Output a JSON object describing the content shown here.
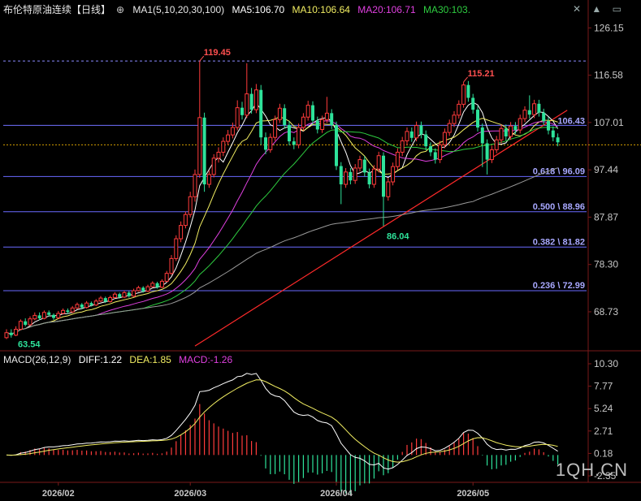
{
  "header": {
    "instrument": "布伦特原油连续",
    "period": "【日线】",
    "ma_label": "MA1(5,10,20,30,100)",
    "ma5": "MA5:106.70",
    "ma10": "MA10:106.64",
    "ma20": "MA20:106.71",
    "ma30": "MA30:103."
  },
  "icons": [
    "target-icon",
    "close-icon",
    "chevron-up-icon",
    "minimize-icon",
    "restore-icon"
  ],
  "macd_header": {
    "label": "MACD(26,12,9)",
    "diff": "DIFF:1.22",
    "dea": "DEA:1.85",
    "macd": "MACD:-1.26"
  },
  "watermark": "1QH.CN",
  "colors": {
    "up": "#ff3b3b",
    "down": "#2ee29a",
    "ma5": "#ffffff",
    "ma10": "#f2ee62",
    "ma20": "#e040e0",
    "ma30": "#2ecc40",
    "ma100": "#9a9a9a",
    "trendline": "#ff2a2a",
    "fib": "#6a6aff",
    "axis_text": "#c8c8c8"
  },
  "chart_data": [
    {
      "type": "candlestick",
      "title": "布伦特原油连续【日线】",
      "y_axis_ticks": [
        "126.15",
        "116.58",
        "107.01",
        "97.44",
        "87.87",
        "78.30",
        "68.73"
      ],
      "ylim": [
        61.5,
        128.5
      ],
      "x_tick_labels": [
        "2026/02",
        "2026/03",
        "2026/04",
        "2026/05"
      ],
      "annotations": [
        {
          "text": "119.45",
          "value": 119.45,
          "kind": "high"
        },
        {
          "text": "115.21",
          "value": 115.21,
          "kind": "high"
        },
        {
          "text": "86.04",
          "value": 86.04,
          "kind": "low"
        },
        {
          "text": "63.54",
          "value": 63.54,
          "kind": "low"
        },
        {
          "text": "106.43",
          "value": 106.43,
          "kind": "last"
        }
      ],
      "fibonacci": [
        {
          "label": "0.618 \\ 96.09",
          "value": 96.09
        },
        {
          "label": "0.500 \\ 88.96",
          "value": 88.96
        },
        {
          "label": "0.382 \\ 81.82",
          "value": 81.82
        },
        {
          "label": "0.236 \\ 72.99",
          "value": 72.99
        }
      ],
      "reference_levels": [
        119.45,
        106.43,
        102.5
      ],
      "trendline": {
        "start": {
          "index": 40,
          "value": 61.8
        },
        "end": {
          "index": 119,
          "value": 109.5
        }
      },
      "series_names": [
        "MA5",
        "MA10",
        "MA20",
        "MA30",
        "MA100"
      ],
      "close": [
        64.5,
        64.0,
        65.2,
        66.8,
        66.1,
        67.3,
        68.0,
        67.4,
        68.6,
        68.1,
        67.5,
        68.4,
        69.0,
        68.7,
        69.5,
        70.2,
        69.6,
        70.5,
        70.1,
        70.9,
        71.5,
        70.8,
        71.6,
        72.3,
        71.7,
        72.6,
        71.9,
        73.0,
        73.6,
        72.9,
        73.8,
        74.5,
        73.7,
        74.9,
        76.5,
        79.5,
        83.5,
        86.2,
        88.4,
        92.0,
        96.5,
        108.0,
        94.5,
        96.5,
        99.8,
        101.0,
        103.2,
        104.5,
        106.0,
        110.0,
        108.5,
        112.8,
        109.6,
        113.6,
        104.0,
        101.5,
        104.0,
        107.6,
        109.9,
        106.5,
        103.2,
        102.5,
        106.0,
        108.1,
        110.5,
        107.4,
        105.6,
        107.6,
        108.9,
        106.5,
        98.2,
        94.5,
        97.0,
        95.3,
        97.8,
        99.5,
        96.9,
        94.5,
        97.6,
        100.3,
        92.0,
        95.0,
        98.1,
        101.0,
        103.3,
        105.2,
        103.9,
        106.4,
        104.6,
        102.2,
        101.0,
        99.5,
        102.5,
        105.0,
        106.8,
        108.5,
        110.7,
        114.6,
        112.0,
        109.6,
        106.0,
        102.8,
        99.5,
        101.5,
        103.5,
        105.8,
        104.2,
        106.3,
        105.5,
        107.8,
        109.5,
        108.6,
        110.8,
        109.0,
        107.3,
        105.4,
        104.0,
        103.0
      ],
      "candles": [
        {
          "o": 63.5,
          "h": 65.2,
          "l": 63.2,
          "c": 64.5
        },
        {
          "o": 64.5,
          "h": 65.2,
          "l": 63.5,
          "c": 64.0
        },
        {
          "o": 64.0,
          "h": 65.8,
          "l": 63.8,
          "c": 65.2
        },
        {
          "o": 65.2,
          "h": 67.2,
          "l": 65.0,
          "c": 66.8
        },
        {
          "o": 66.8,
          "h": 67.4,
          "l": 65.8,
          "c": 66.1
        },
        {
          "o": 66.1,
          "h": 67.8,
          "l": 65.9,
          "c": 67.3
        },
        {
          "o": 67.3,
          "h": 68.6,
          "l": 67.0,
          "c": 68.0
        },
        {
          "o": 68.0,
          "h": 68.6,
          "l": 67.0,
          "c": 67.4
        },
        {
          "o": 67.4,
          "h": 69.0,
          "l": 67.2,
          "c": 68.6
        },
        {
          "o": 68.6,
          "h": 69.0,
          "l": 67.8,
          "c": 68.1
        },
        {
          "o": 68.1,
          "h": 68.4,
          "l": 67.1,
          "c": 67.5
        },
        {
          "o": 67.5,
          "h": 68.9,
          "l": 67.3,
          "c": 68.4
        },
        {
          "o": 68.4,
          "h": 69.4,
          "l": 68.2,
          "c": 69.0
        },
        {
          "o": 69.0,
          "h": 69.4,
          "l": 68.3,
          "c": 68.7
        },
        {
          "o": 68.7,
          "h": 69.9,
          "l": 68.5,
          "c": 69.5
        },
        {
          "o": 69.5,
          "h": 70.6,
          "l": 69.3,
          "c": 70.2
        },
        {
          "o": 70.2,
          "h": 70.5,
          "l": 69.2,
          "c": 69.6
        },
        {
          "o": 69.6,
          "h": 70.9,
          "l": 69.4,
          "c": 70.5
        },
        {
          "o": 70.5,
          "h": 70.8,
          "l": 69.8,
          "c": 70.1
        },
        {
          "o": 70.1,
          "h": 71.3,
          "l": 69.9,
          "c": 70.9
        },
        {
          "o": 70.9,
          "h": 71.9,
          "l": 70.7,
          "c": 71.5
        },
        {
          "o": 71.5,
          "h": 71.8,
          "l": 70.5,
          "c": 70.8
        },
        {
          "o": 70.8,
          "h": 72.0,
          "l": 70.6,
          "c": 71.6
        },
        {
          "o": 71.6,
          "h": 72.7,
          "l": 71.4,
          "c": 72.3
        },
        {
          "o": 72.3,
          "h": 72.6,
          "l": 71.4,
          "c": 71.7
        },
        {
          "o": 71.7,
          "h": 73.0,
          "l": 71.5,
          "c": 72.6
        },
        {
          "o": 72.6,
          "h": 72.9,
          "l": 71.6,
          "c": 71.9
        },
        {
          "o": 71.9,
          "h": 73.4,
          "l": 71.7,
          "c": 73.0
        },
        {
          "o": 73.0,
          "h": 74.0,
          "l": 72.8,
          "c": 73.6
        },
        {
          "o": 73.6,
          "h": 73.9,
          "l": 72.6,
          "c": 72.9
        },
        {
          "o": 72.9,
          "h": 74.2,
          "l": 72.7,
          "c": 73.8
        },
        {
          "o": 73.8,
          "h": 74.9,
          "l": 73.6,
          "c": 74.5
        },
        {
          "o": 74.5,
          "h": 74.8,
          "l": 73.4,
          "c": 73.7
        },
        {
          "o": 73.7,
          "h": 75.3,
          "l": 73.5,
          "c": 74.9
        },
        {
          "o": 74.9,
          "h": 77.0,
          "l": 74.7,
          "c": 76.5
        },
        {
          "o": 76.5,
          "h": 80.2,
          "l": 76.2,
          "c": 79.5
        },
        {
          "o": 79.5,
          "h": 84.2,
          "l": 79.0,
          "c": 83.5
        },
        {
          "o": 83.5,
          "h": 87.0,
          "l": 82.8,
          "c": 86.2
        },
        {
          "o": 86.2,
          "h": 89.0,
          "l": 85.6,
          "c": 88.4
        },
        {
          "o": 88.4,
          "h": 93.0,
          "l": 87.8,
          "c": 92.0
        },
        {
          "o": 92.0,
          "h": 97.5,
          "l": 91.0,
          "c": 96.5
        },
        {
          "o": 96.5,
          "h": 119.45,
          "l": 95.8,
          "c": 108.0
        },
        {
          "o": 108.0,
          "h": 109.0,
          "l": 93.0,
          "c": 94.5
        },
        {
          "o": 94.5,
          "h": 97.3,
          "l": 93.8,
          "c": 96.5
        },
        {
          "o": 96.5,
          "h": 100.6,
          "l": 95.9,
          "c": 99.8
        },
        {
          "o": 99.8,
          "h": 102.0,
          "l": 98.9,
          "c": 101.0
        },
        {
          "o": 101.0,
          "h": 104.0,
          "l": 100.2,
          "c": 103.2
        },
        {
          "o": 103.2,
          "h": 105.5,
          "l": 102.5,
          "c": 104.5
        },
        {
          "o": 104.5,
          "h": 107.0,
          "l": 103.8,
          "c": 106.0
        },
        {
          "o": 106.0,
          "h": 111.5,
          "l": 105.4,
          "c": 110.0
        },
        {
          "o": 110.0,
          "h": 111.2,
          "l": 107.6,
          "c": 108.5
        },
        {
          "o": 108.5,
          "h": 119.0,
          "l": 107.9,
          "c": 112.8
        },
        {
          "o": 112.8,
          "h": 114.0,
          "l": 108.8,
          "c": 109.6
        },
        {
          "o": 109.6,
          "h": 114.8,
          "l": 108.9,
          "c": 113.6
        },
        {
          "o": 113.6,
          "h": 114.6,
          "l": 102.5,
          "c": 104.0
        },
        {
          "o": 104.0,
          "h": 105.0,
          "l": 100.6,
          "c": 101.5
        },
        {
          "o": 101.5,
          "h": 104.8,
          "l": 100.9,
          "c": 104.0
        },
        {
          "o": 104.0,
          "h": 108.4,
          "l": 103.3,
          "c": 107.6
        },
        {
          "o": 107.6,
          "h": 110.8,
          "l": 106.9,
          "c": 109.9
        },
        {
          "o": 109.9,
          "h": 110.7,
          "l": 105.8,
          "c": 106.5
        },
        {
          "o": 106.5,
          "h": 107.3,
          "l": 102.4,
          "c": 103.2
        },
        {
          "o": 103.2,
          "h": 104.0,
          "l": 101.6,
          "c": 102.5
        },
        {
          "o": 102.5,
          "h": 106.8,
          "l": 101.8,
          "c": 106.0
        },
        {
          "o": 106.0,
          "h": 108.9,
          "l": 105.3,
          "c": 108.1
        },
        {
          "o": 108.1,
          "h": 111.4,
          "l": 107.4,
          "c": 110.5
        },
        {
          "o": 110.5,
          "h": 111.3,
          "l": 106.6,
          "c": 107.4
        },
        {
          "o": 107.4,
          "h": 108.2,
          "l": 104.8,
          "c": 105.6
        },
        {
          "o": 105.6,
          "h": 108.4,
          "l": 104.9,
          "c": 107.6
        },
        {
          "o": 107.6,
          "h": 112.2,
          "l": 106.9,
          "c": 108.9
        },
        {
          "o": 108.9,
          "h": 109.7,
          "l": 105.7,
          "c": 106.5
        },
        {
          "o": 106.5,
          "h": 107.2,
          "l": 97.4,
          "c": 98.2
        },
        {
          "o": 98.2,
          "h": 99.0,
          "l": 90.5,
          "c": 94.5
        },
        {
          "o": 94.5,
          "h": 97.8,
          "l": 93.8,
          "c": 97.0
        },
        {
          "o": 97.0,
          "h": 97.8,
          "l": 94.5,
          "c": 95.3
        },
        {
          "o": 95.3,
          "h": 98.6,
          "l": 94.6,
          "c": 97.8
        },
        {
          "o": 97.8,
          "h": 100.3,
          "l": 97.1,
          "c": 99.5
        },
        {
          "o": 99.5,
          "h": 100.2,
          "l": 96.1,
          "c": 96.9
        },
        {
          "o": 96.9,
          "h": 97.7,
          "l": 93.7,
          "c": 94.5
        },
        {
          "o": 94.5,
          "h": 98.4,
          "l": 93.8,
          "c": 97.6
        },
        {
          "o": 97.6,
          "h": 101.1,
          "l": 96.9,
          "c": 100.3
        },
        {
          "o": 100.3,
          "h": 101.0,
          "l": 86.04,
          "c": 92.0
        },
        {
          "o": 92.0,
          "h": 95.8,
          "l": 91.2,
          "c": 95.0
        },
        {
          "o": 95.0,
          "h": 98.9,
          "l": 94.3,
          "c": 98.1
        },
        {
          "o": 98.1,
          "h": 101.8,
          "l": 97.4,
          "c": 101.0
        },
        {
          "o": 101.0,
          "h": 104.1,
          "l": 100.2,
          "c": 103.3
        },
        {
          "o": 103.3,
          "h": 106.0,
          "l": 102.5,
          "c": 105.2
        },
        {
          "o": 105.2,
          "h": 106.0,
          "l": 103.1,
          "c": 103.9
        },
        {
          "o": 103.9,
          "h": 107.2,
          "l": 103.2,
          "c": 106.4
        },
        {
          "o": 106.4,
          "h": 107.2,
          "l": 103.8,
          "c": 104.6
        },
        {
          "o": 104.6,
          "h": 105.4,
          "l": 101.4,
          "c": 102.2
        },
        {
          "o": 102.2,
          "h": 103.0,
          "l": 100.2,
          "c": 101.0
        },
        {
          "o": 101.0,
          "h": 101.8,
          "l": 98.7,
          "c": 99.5
        },
        {
          "o": 99.5,
          "h": 103.3,
          "l": 98.8,
          "c": 102.5
        },
        {
          "o": 102.5,
          "h": 105.8,
          "l": 101.8,
          "c": 105.0
        },
        {
          "o": 105.0,
          "h": 107.6,
          "l": 104.3,
          "c": 106.8
        },
        {
          "o": 106.8,
          "h": 109.3,
          "l": 106.1,
          "c": 108.5
        },
        {
          "o": 108.5,
          "h": 111.5,
          "l": 107.8,
          "c": 110.7
        },
        {
          "o": 110.7,
          "h": 115.21,
          "l": 110.0,
          "c": 114.6
        },
        {
          "o": 114.6,
          "h": 115.4,
          "l": 111.2,
          "c": 112.0
        },
        {
          "o": 112.0,
          "h": 112.8,
          "l": 108.8,
          "c": 109.6
        },
        {
          "o": 109.6,
          "h": 110.4,
          "l": 105.2,
          "c": 106.0
        },
        {
          "o": 106.0,
          "h": 106.8,
          "l": 98.0,
          "c": 102.8
        },
        {
          "o": 102.8,
          "h": 103.6,
          "l": 96.5,
          "c": 99.5
        },
        {
          "o": 99.5,
          "h": 102.3,
          "l": 98.8,
          "c": 101.5
        },
        {
          "o": 101.5,
          "h": 104.3,
          "l": 100.8,
          "c": 103.5
        },
        {
          "o": 103.5,
          "h": 106.6,
          "l": 102.8,
          "c": 105.8
        },
        {
          "o": 105.8,
          "h": 106.6,
          "l": 103.4,
          "c": 104.2
        },
        {
          "o": 104.2,
          "h": 107.1,
          "l": 103.5,
          "c": 106.3
        },
        {
          "o": 106.3,
          "h": 107.1,
          "l": 104.7,
          "c": 105.5
        },
        {
          "o": 105.5,
          "h": 108.6,
          "l": 104.8,
          "c": 107.8
        },
        {
          "o": 107.8,
          "h": 110.3,
          "l": 107.1,
          "c": 109.5
        },
        {
          "o": 109.5,
          "h": 112.5,
          "l": 107.8,
          "c": 108.6
        },
        {
          "o": 108.6,
          "h": 111.6,
          "l": 107.9,
          "c": 110.8
        },
        {
          "o": 110.8,
          "h": 111.6,
          "l": 108.2,
          "c": 109.0
        },
        {
          "o": 109.0,
          "h": 109.8,
          "l": 106.5,
          "c": 107.3
        },
        {
          "o": 107.3,
          "h": 108.1,
          "l": 104.6,
          "c": 105.4
        },
        {
          "o": 105.4,
          "h": 106.2,
          "l": 103.2,
          "c": 104.0
        },
        {
          "o": 104.0,
          "h": 104.8,
          "l": 102.2,
          "c": 103.0
        }
      ]
    },
    {
      "type": "line",
      "title": "MACD(26,12,9)",
      "y_axis_ticks": [
        "10.30",
        "7.77",
        "5.24",
        "2.71",
        "0.18",
        "-2.35"
      ],
      "ylim": [
        -2.35,
        10.3
      ],
      "series_names": [
        "DIFF",
        "DEA",
        "MACD"
      ],
      "last_values": {
        "DIFF": 1.22,
        "DEA": 1.85,
        "MACD": -1.26
      }
    }
  ]
}
